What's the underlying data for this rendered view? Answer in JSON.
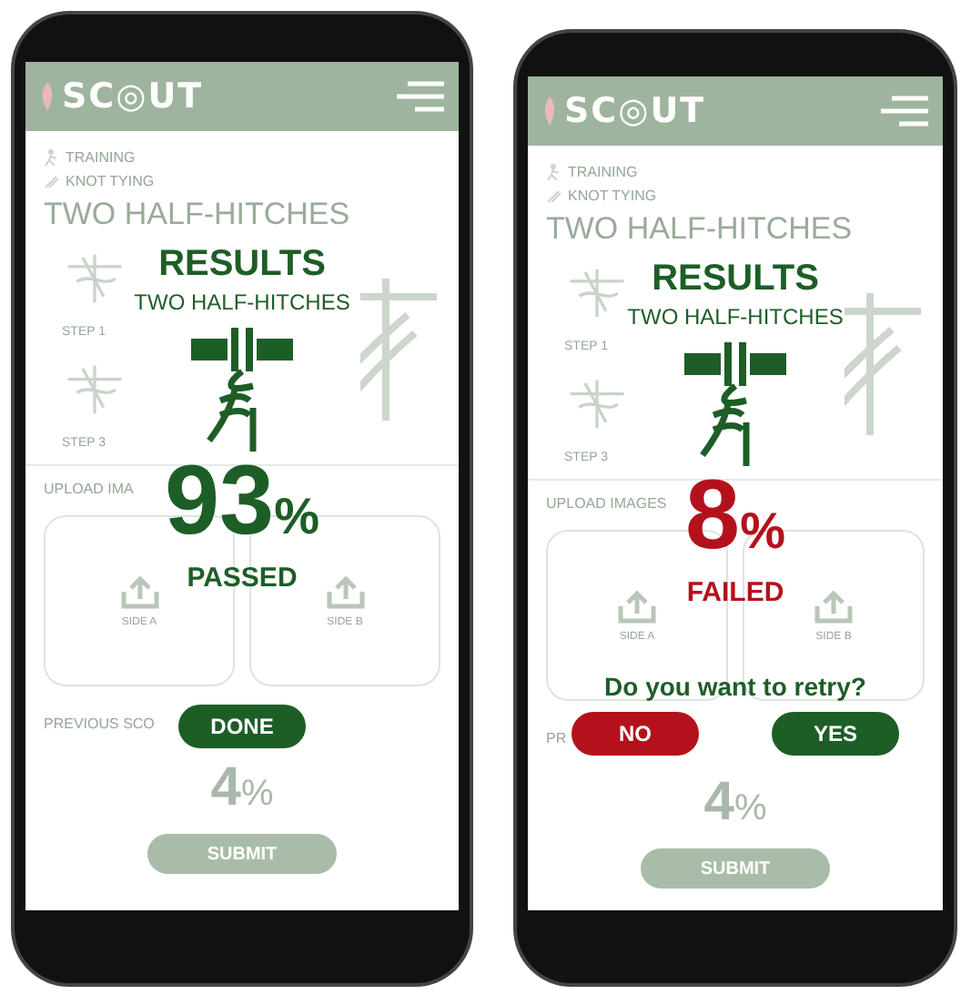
{
  "phones": [
    {
      "background": {
        "logo": "SC◎UT",
        "breadcrumbs": [
          {
            "kind": "training",
            "label": "TRAINING"
          },
          {
            "kind": "knot",
            "label": "KNOT TYING"
          }
        ],
        "title": "TWO HALF-HITCHES",
        "steps": [
          "STEP 1",
          "STEP 3"
        ],
        "upload_label": "UPLOAD IMA",
        "sides": [
          "SIDE A",
          "SIDE B"
        ],
        "previous_label": "PREVIOUS SCO",
        "previous_score": "4",
        "previous_unit": "%",
        "submit": "SUBMIT"
      },
      "result": {
        "title": "RESULTS",
        "subtitle": "TWO HALF-HITCHES",
        "score": "93",
        "unit": "%",
        "passed": true,
        "outcome_label": "PASSED",
        "buttons": [
          {
            "label": "DONE",
            "kind": "confirm"
          }
        ]
      }
    },
    {
      "background": {
        "logo": "SC◎UT",
        "breadcrumbs": [
          {
            "kind": "training",
            "label": "TRAINING"
          },
          {
            "kind": "knot",
            "label": "KNOT TYING"
          }
        ],
        "title": "TWO HALF-HITCHES",
        "steps": [
          "STEP 1",
          "STEP 3"
        ],
        "upload_label": "UPLOAD IMAGES",
        "sides": [
          "SIDE A",
          "SIDE B"
        ],
        "previous_label": "PR",
        "previous_score": "4",
        "previous_unit": "%",
        "submit": "SUBMIT"
      },
      "result": {
        "title": "RESULTS",
        "subtitle": "TWO HALF-HITCHES",
        "score": "8",
        "unit": "%",
        "passed": false,
        "outcome_label": "FAILED",
        "question": "Do you want to retry?",
        "buttons": [
          {
            "label": "NO",
            "kind": "cancel"
          },
          {
            "label": "YES",
            "kind": "confirm"
          }
        ]
      }
    }
  ]
}
